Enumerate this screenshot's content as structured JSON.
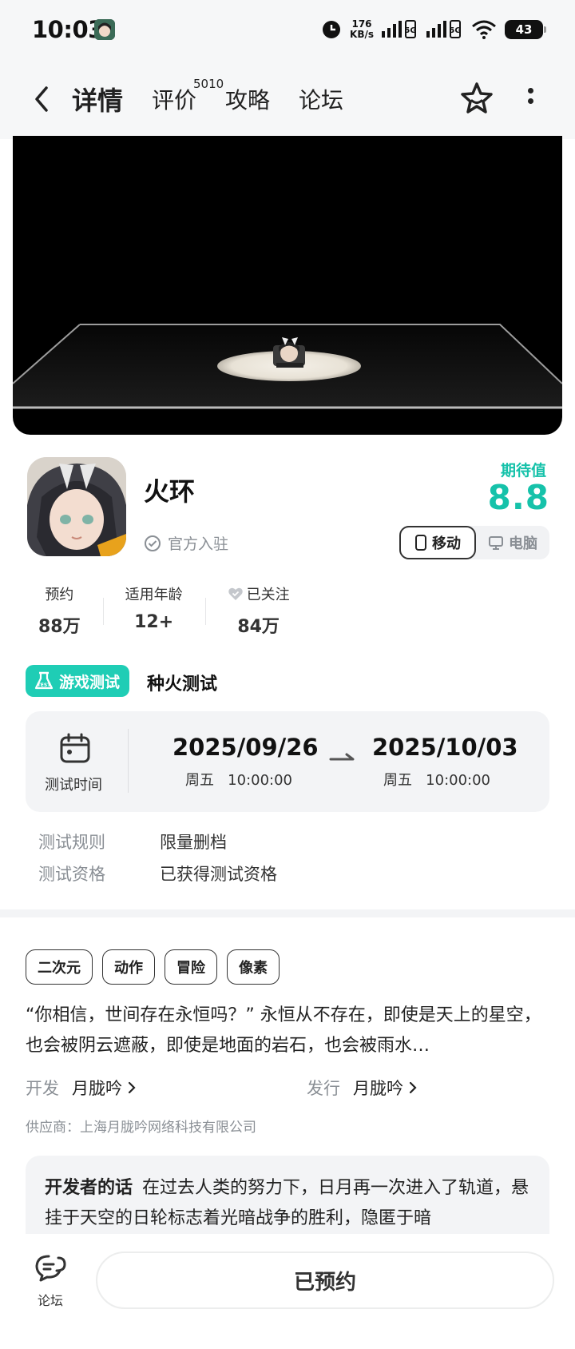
{
  "status_bar": {
    "time": "10:03",
    "speed_value": "176",
    "speed_unit": "KB/s",
    "battery": "43"
  },
  "header": {
    "tabs": [
      "详情",
      "评价",
      "攻略",
      "论坛"
    ],
    "review_count": "5010"
  },
  "game": {
    "title": "火环",
    "official_label": "官方入驻",
    "expect_label": "期待值",
    "expect_value": "8.8",
    "platforms": [
      "移动",
      "电脑"
    ]
  },
  "stats": [
    {
      "label": "预约",
      "value": "88万"
    },
    {
      "label": "适用年龄",
      "value": "12+"
    },
    {
      "label": "已关注",
      "value": "84万"
    }
  ],
  "test": {
    "badge": "游戏测试",
    "name": "种火测试",
    "time_label": "测试时间",
    "start_date": "2025/09/26",
    "start_time": "周五   10:00:00",
    "end_date": "2025/10/03",
    "end_time": "周五   10:00:00",
    "rules": [
      {
        "key": "测试规则",
        "value": "限量删档"
      },
      {
        "key": "测试资格",
        "value": "已获得测试资格"
      }
    ]
  },
  "tags": [
    "二次元",
    "动作",
    "冒险",
    "像素"
  ],
  "description": "“你相信，世间存在永恒吗？” 永恒从不存在，即使是天上的星空，也会被阴云遮蔽，即使是地面的岩石，也会被雨水…",
  "developer": {
    "label": "开发",
    "name": "月胧吟"
  },
  "publisher": {
    "label": "发行",
    "name": "月胧吟"
  },
  "supplier": "供应商：上海月胧吟网络科技有限公司",
  "dev_words": {
    "title": "开发者的话",
    "text": "在过去人类的努力下，日月再一次进入了轨道，悬挂于天空的日轮标志着光暗战争的胜利，隐匿于暗"
  },
  "bottom": {
    "forum_label": "论坛",
    "reserved_label": "已预约"
  },
  "colors": {
    "accent": "#1fcdb5",
    "expect": "#16c2aa"
  }
}
